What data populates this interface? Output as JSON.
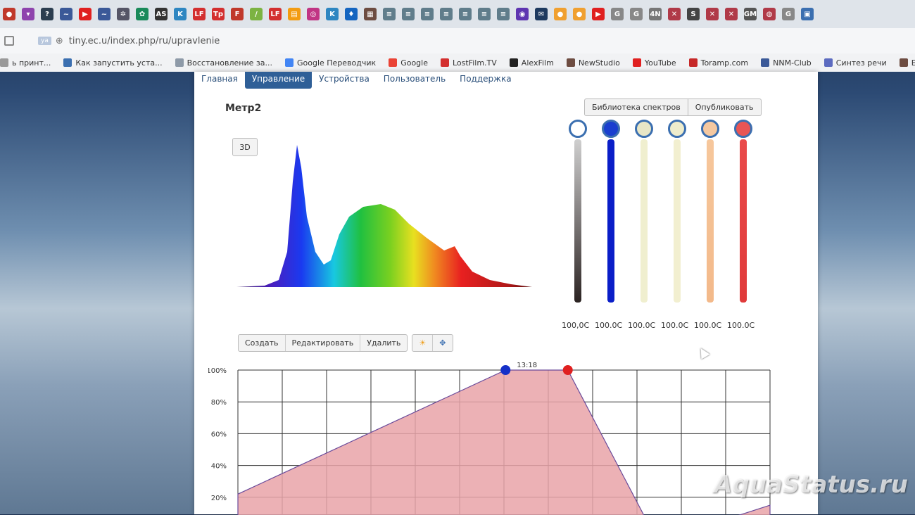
{
  "browser": {
    "tab_icons": [
      {
        "name": "app-icon",
        "color": "#c0392b",
        "glyph": "●"
      },
      {
        "name": "bookmark-icon",
        "color": "#8e44ad",
        "glyph": "▾"
      },
      {
        "name": "help-icon",
        "color": "#2c3e50",
        "glyph": "?"
      },
      {
        "name": "nnm-icon",
        "color": "#3b5998",
        "glyph": "~"
      },
      {
        "name": "youtube-icon",
        "color": "#e02020",
        "glyph": "▶"
      },
      {
        "name": "nnm-icon",
        "color": "#3b5998",
        "glyph": "~"
      },
      {
        "name": "settings-icon",
        "color": "#556",
        "glyph": "✲"
      },
      {
        "name": "flower-icon",
        "color": "#1a8a5a",
        "glyph": "✿"
      },
      {
        "name": "as-icon",
        "color": "#333",
        "glyph": "AS"
      },
      {
        "name": "k-icon",
        "color": "#2e86c1",
        "glyph": "K"
      },
      {
        "name": "lf-icon",
        "color": "#d32f2f",
        "glyph": "LF"
      },
      {
        "name": "tp-icon",
        "color": "#d32f2f",
        "glyph": "Tp"
      },
      {
        "name": "f-icon",
        "color": "#c0392b",
        "glyph": "F"
      },
      {
        "name": "leaf-icon",
        "color": "#7cb342",
        "glyph": "/"
      },
      {
        "name": "lf-icon",
        "color": "#d32f2f",
        "glyph": "LF"
      },
      {
        "name": "chart-icon",
        "color": "#f39c12",
        "glyph": "▤"
      },
      {
        "name": "instagram-icon",
        "color": "#c13584",
        "glyph": "◎"
      },
      {
        "name": "k-icon",
        "color": "#2e86c1",
        "glyph": "K"
      },
      {
        "name": "drop-icon",
        "color": "#1565c0",
        "glyph": "♦"
      },
      {
        "name": "film-icon",
        "color": "#6d4c41",
        "glyph": "▦"
      },
      {
        "name": "list-icon",
        "color": "#607d8b",
        "glyph": "≡"
      },
      {
        "name": "list-icon",
        "color": "#607d8b",
        "glyph": "≡"
      },
      {
        "name": "list-icon",
        "color": "#607d8b",
        "glyph": "≡"
      },
      {
        "name": "list-icon",
        "color": "#607d8b",
        "glyph": "≡"
      },
      {
        "name": "list-icon",
        "color": "#607d8b",
        "glyph": "≡"
      },
      {
        "name": "list-icon",
        "color": "#607d8b",
        "glyph": "≡"
      },
      {
        "name": "list-icon",
        "color": "#607d8b",
        "glyph": "≡"
      },
      {
        "name": "radio-icon",
        "color": "#5e35b1",
        "glyph": "◉"
      },
      {
        "name": "mail-icon",
        "color": "#1e3a5f",
        "glyph": "✉"
      },
      {
        "name": "orange-icon",
        "color": "#f0a030",
        "glyph": "●"
      },
      {
        "name": "orange-icon",
        "color": "#f0a030",
        "glyph": "●"
      },
      {
        "name": "youtube-icon",
        "color": "#e02020",
        "glyph": "▶"
      },
      {
        "name": "google-icon",
        "color": "#888",
        "glyph": "G"
      },
      {
        "name": "google-icon",
        "color": "#888",
        "glyph": "G"
      },
      {
        "name": "4n-icon",
        "color": "#777",
        "glyph": "4N"
      },
      {
        "name": "x-icon",
        "color": "#b03a48",
        "glyph": "✕"
      },
      {
        "name": "s-icon",
        "color": "#444",
        "glyph": "S"
      },
      {
        "name": "x-icon",
        "color": "#b03a48",
        "glyph": "✕"
      },
      {
        "name": "x-icon",
        "color": "#b03a48",
        "glyph": "✕"
      },
      {
        "name": "gm-icon",
        "color": "#555",
        "glyph": "GM"
      },
      {
        "name": "circle-icon",
        "color": "#b03a48",
        "glyph": "◍"
      },
      {
        "name": "google-icon",
        "color": "#888",
        "glyph": "G"
      },
      {
        "name": "window-icon",
        "color": "#3b6fb0",
        "glyph": "▣"
      }
    ],
    "url_chip": "ya",
    "url": "tiny.ec.u/index.php/ru/upravlenie",
    "bookmarks": [
      {
        "label": "ь принт...",
        "color": "#999"
      },
      {
        "label": "Как запустить уста...",
        "color": "#3b6fb0"
      },
      {
        "label": "Восстановление за...",
        "color": "#8e9aa8"
      },
      {
        "label": "Google Переводчик",
        "color": "#4285f4"
      },
      {
        "label": "Google",
        "color": "#ea4335"
      },
      {
        "label": "LostFilm.TV",
        "color": "#d32f2f"
      },
      {
        "label": "AlexFilm",
        "color": "#222"
      },
      {
        "label": "NewStudio",
        "color": "#6d4c41"
      },
      {
        "label": "YouTube",
        "color": "#e02020"
      },
      {
        "label": "Toramp.com",
        "color": "#c62828"
      },
      {
        "label": "NNM-Club",
        "color": "#3b5998"
      },
      {
        "label": "Синтез речи",
        "color": "#5c6bc0"
      },
      {
        "label": "Ева-Поддержка Ал...",
        "color": "#6d4c41"
      }
    ]
  },
  "nav": {
    "items": [
      "Главная",
      "Управление",
      "Устройства",
      "Пользователь",
      "Поддержка"
    ],
    "active": "Управление"
  },
  "page_title": "Метр2",
  "button_3d": "3D",
  "library": {
    "spectra": "Библиотека спектров",
    "publish": "Опубликовать"
  },
  "channels": [
    {
      "name": "white",
      "knob": "#ffffff",
      "track_top": "#cfcfcf",
      "track_bottom": "#2b2322",
      "value": "100,0C"
    },
    {
      "name": "royal-blue",
      "knob": "#1a3fcf",
      "track_top": "#0a1ec8",
      "track_bottom": "#0a1ec8",
      "value": "100.0C"
    },
    {
      "name": "cool-yellow",
      "knob": "#e8e6c6",
      "track_top": "#f0efcf",
      "track_bottom": "#f0efcf",
      "value": "100.0C"
    },
    {
      "name": "warm-yellow",
      "knob": "#eeeccc",
      "track_top": "#f2efd0",
      "track_bottom": "#f2efd0",
      "value": "100.0C"
    },
    {
      "name": "orange",
      "knob": "#f5c8a0",
      "track_top": "#f6c79c",
      "track_bottom": "#f3b98a",
      "value": "100.0C"
    },
    {
      "name": "red",
      "knob": "#e85555",
      "track_top": "#e94a4a",
      "track_bottom": "#e03a3a",
      "value": "100.0C"
    }
  ],
  "channel_levels": [
    1,
    1,
    1,
    1,
    1,
    1
  ],
  "toolbar": {
    "create": "Создать",
    "edit": "Редактировать",
    "delete": "Удалить"
  },
  "chart_data": {
    "type": "area",
    "y_tick_labels": [
      "100%",
      "80%",
      "60%",
      "40%",
      "20%"
    ],
    "ylim": [
      0,
      100
    ],
    "grid": true,
    "fill_color": "#e9a3a8",
    "line_color": "#6a4a9a",
    "series": [
      {
        "x": [
          0.0,
          0.503,
          0.62,
          0.775,
          0.87,
          1.0
        ],
        "values": [
          22,
          100,
          100,
          1,
          1,
          15
        ]
      }
    ],
    "markers": [
      {
        "x": 0.503,
        "y": 100,
        "color": "#1530c8"
      },
      {
        "x": 0.62,
        "y": 100,
        "color": "#e02020"
      }
    ],
    "time_label": "13:18"
  },
  "watermark": "AquaStatus.ru"
}
